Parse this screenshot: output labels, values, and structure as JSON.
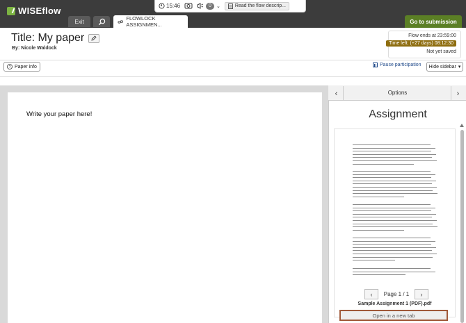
{
  "topbar": {
    "logo_text": "WISEflow",
    "exit_label": "Exit",
    "tab_label": "FLOWLOCK ASSIGNMEN...",
    "timer": "15:46",
    "notification_count": "0",
    "flow_description_label": "Read the flow descrip...",
    "submit_label": "Go to submission",
    "accent_color": "#5b7f25"
  },
  "header": {
    "title": "Title: My paper",
    "byline": "By: Nicole Waldock",
    "flow_ends": "Flow ends at 23:59:00",
    "time_left": "Time left: (+27 days) 08:12:30",
    "save_status": "Not yet saved",
    "time_left_color": "#8e6d0f"
  },
  "toolbar": {
    "paper_info_label": "Paper info",
    "pause_label": "Pause participation",
    "hide_sidebar_label": "Hide sidebar"
  },
  "editor": {
    "placeholder_text": "Write your paper here!"
  },
  "sidebar": {
    "options_label": "Options",
    "heading": "Assignment",
    "page_indicator": "Page 1 / 1",
    "document_name": "Sample Assignment 1 (PDF).pdf",
    "open_tab_label": "Open in a new tab"
  }
}
